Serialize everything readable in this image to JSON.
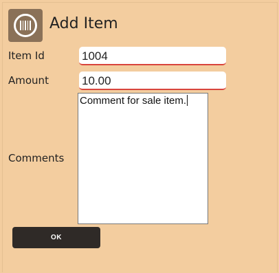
{
  "header": {
    "title": "Add Item",
    "icon": "barcode-icon"
  },
  "form": {
    "item_id": {
      "label": "Item Id",
      "value": "1004"
    },
    "amount": {
      "label": "Amount",
      "value": "10.00"
    },
    "comments": {
      "label": "Comments",
      "value": "Comment for sale item."
    }
  },
  "actions": {
    "ok_label": "OK"
  },
  "colors": {
    "background": "#f3cd9f",
    "icon_tile": "#8a7158",
    "field_underline": "#d9443c",
    "button": "#2f2a27"
  }
}
